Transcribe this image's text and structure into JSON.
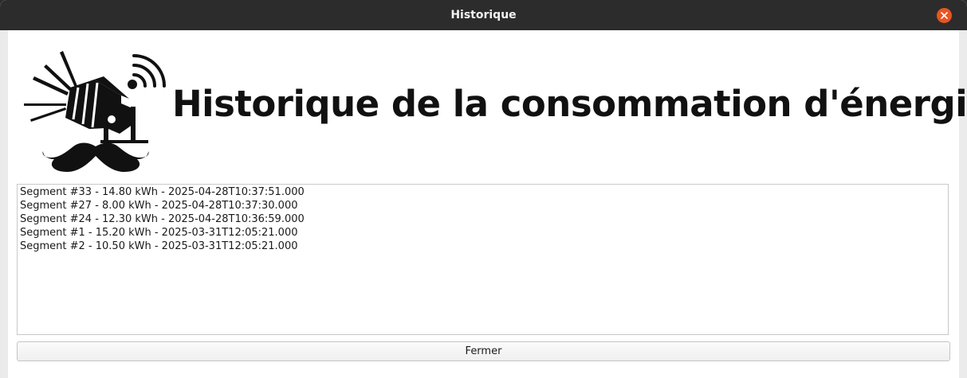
{
  "window": {
    "title": "Historique"
  },
  "header": {
    "title": "Historique de la consommation d'énergie"
  },
  "segments": [
    "Segment #33 - 14.80 kWh - 2025-04-28T10:37:51.000",
    "Segment #27 - 8.00 kWh - 2025-04-28T10:37:30.000",
    "Segment #24 - 12.30 kWh - 2025-04-28T10:36:59.000",
    "Segment #1 - 15.20 kWh - 2025-03-31T12:05:21.000",
    "Segment #2 - 10.50 kWh - 2025-03-31T12:05:21.000"
  ],
  "footer": {
    "close_label": "Fermer"
  },
  "colors": {
    "titlebar": "#2c2c2c",
    "close_button_accent": "#e95420",
    "content_background": "#ffffff"
  },
  "icons": {
    "logo": "spotlight-with-mustache-logo",
    "window_close": "close-icon"
  }
}
